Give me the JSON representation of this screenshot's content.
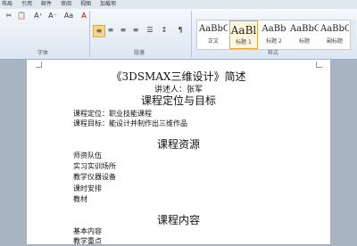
{
  "menu": {
    "tabs": [
      "布局",
      "引用",
      "邮件",
      "审阅",
      "视图",
      "加载项"
    ]
  },
  "toolbar": {
    "row1": [
      "✂",
      "📋",
      "A⁺",
      "A⁻",
      "Aa",
      "A"
    ],
    "row2": [
      "≡",
      "≡",
      "≡",
      "≡",
      "☰",
      "↕",
      "¶"
    ]
  },
  "groups": {
    "font": "字体",
    "paragraph": "段落",
    "styles": "样式"
  },
  "styles": [
    {
      "sample": "AaBbCcDc",
      "name": "正文"
    },
    {
      "sample": "AaBl",
      "name": "标题 1"
    },
    {
      "sample": "AaBb",
      "name": "标题 2"
    },
    {
      "sample": "AaBbC",
      "name": "标题"
    },
    {
      "sample": "AaBbC",
      "name": "副标题"
    }
  ],
  "document": {
    "title": "《3DSMAX三维设计》简述",
    "speaker": "讲述人：张军",
    "h1": "课程定位与目标",
    "position": "课程定位：职业技能课程",
    "goal": "课程目标：能设计并制作出三维作品",
    "h2": "课程资源",
    "res": [
      "师资队伍",
      "实习实训场所",
      "教学仪器设备",
      "课时安排",
      "教材"
    ],
    "h3": "课程内容",
    "content": [
      "基本内容",
      "教学重点"
    ]
  }
}
